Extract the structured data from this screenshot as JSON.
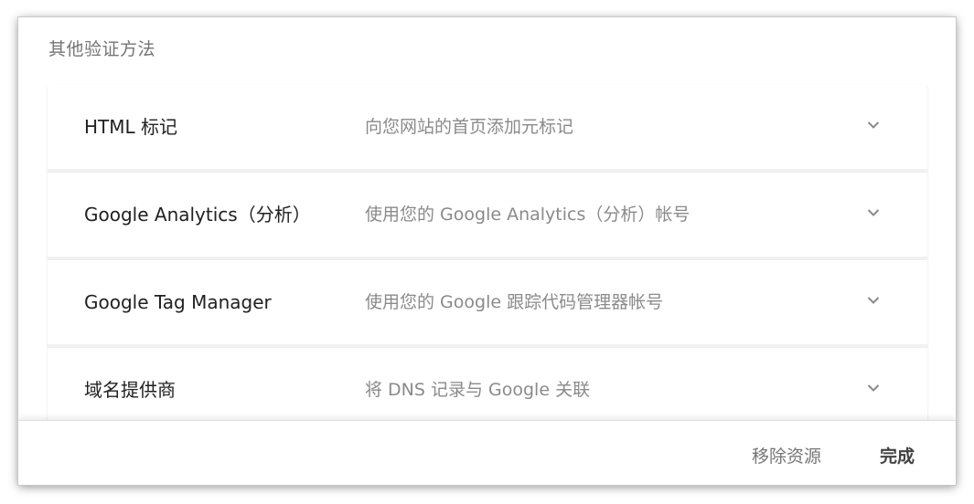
{
  "section_title": "其他验证方法",
  "methods": [
    {
      "name": "HTML 标记",
      "description": "向您网站的首页添加元标记",
      "icon": "chevron-down-icon"
    },
    {
      "name": "Google Analytics（分析）",
      "description": "使用您的 Google Analytics（分析）帐号",
      "icon": "chevron-down-icon"
    },
    {
      "name": "Google Tag Manager",
      "description": "使用您的 Google 跟踪代码管理器帐号",
      "icon": "chevron-down-icon"
    },
    {
      "name": "域名提供商",
      "description": "将 DNS 记录与 Google 关联",
      "icon": "chevron-down-icon"
    }
  ],
  "footer": {
    "remove_label": "移除资源",
    "done_label": "完成"
  },
  "colors": {
    "title_text": "#757575",
    "primary_text": "#212121",
    "secondary_text": "#8a8a8a",
    "row_divider": "#f1f1f1"
  }
}
